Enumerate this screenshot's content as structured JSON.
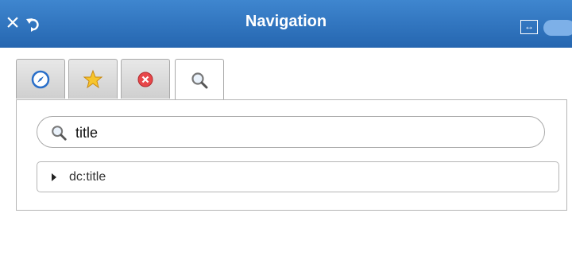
{
  "titlebar": {
    "title": "Navigation",
    "close_icon": "close-icon",
    "undo_icon": "undo-icon",
    "expand_icon": "expand-horizontal-icon",
    "bg_color": "#2e74c0"
  },
  "tabs": [
    {
      "icon": "compass-icon",
      "active": false
    },
    {
      "icon": "star-icon",
      "active": false
    },
    {
      "icon": "error-icon",
      "active": false
    },
    {
      "icon": "search-icon",
      "active": true
    }
  ],
  "search": {
    "value": "title"
  },
  "results": [
    {
      "label": "dc:title"
    }
  ]
}
